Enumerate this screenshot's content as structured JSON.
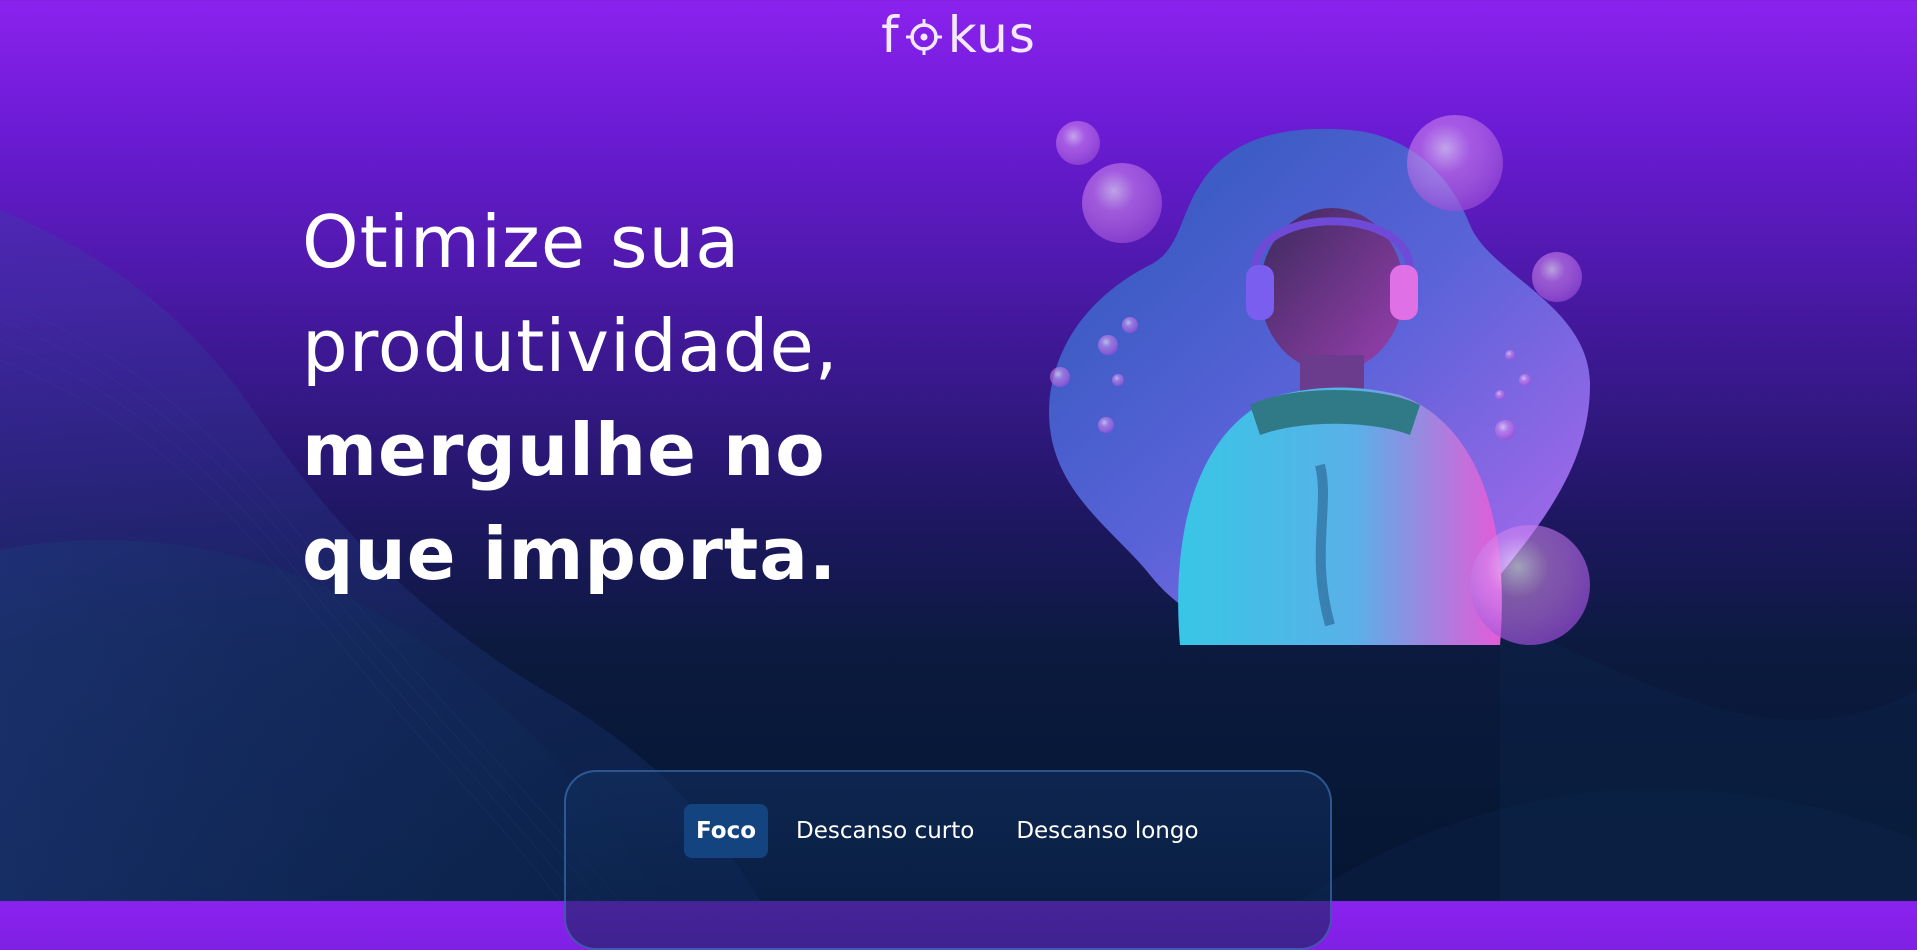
{
  "header": {
    "logo_prefix": "f",
    "logo_suffix": "kus",
    "logo_icon": "crosshair-target-icon"
  },
  "hero": {
    "line1": "Otimize sua",
    "line2": "produtividade,",
    "line3": "mergulhe no",
    "line4": "que importa."
  },
  "illustration": {
    "subject": "person-with-headphones-bubbles-image"
  },
  "timer": {
    "tabs": [
      {
        "label": "Foco",
        "active": true
      },
      {
        "label": "Descanso curto",
        "active": false
      },
      {
        "label": "Descanso longo",
        "active": false
      }
    ]
  },
  "colors": {
    "bg_top": "#8b22ee",
    "bg_bottom": "#041632",
    "tab_active": "#144480",
    "card_border": "#4682c8"
  }
}
